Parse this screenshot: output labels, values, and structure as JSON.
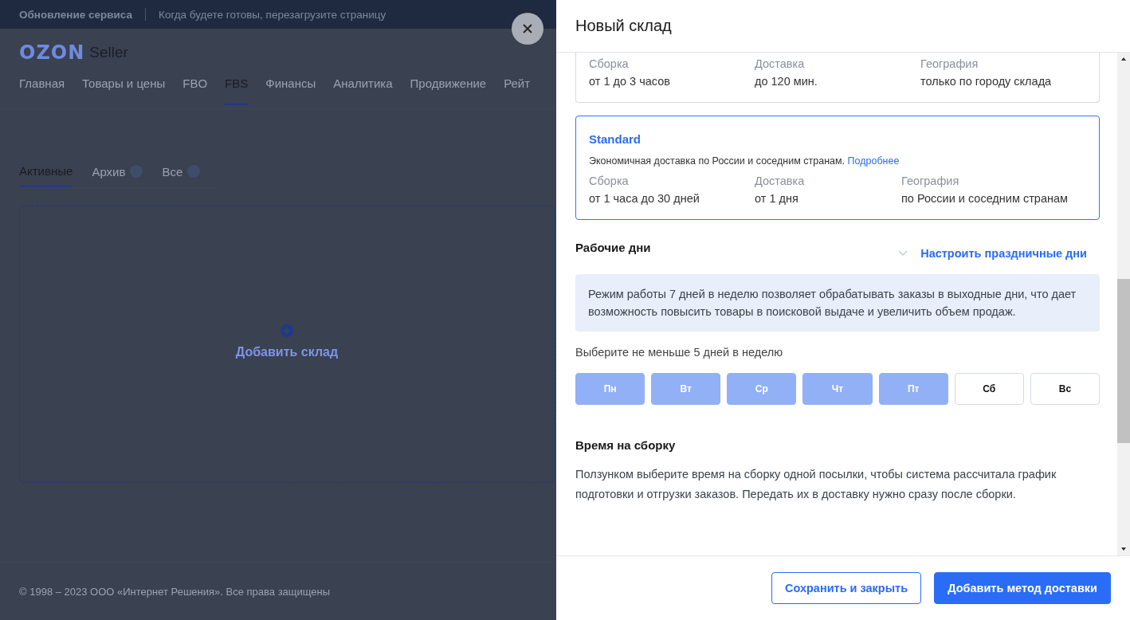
{
  "banner": {
    "title": "Обновление сервиса",
    "text": "Когда будете готовы, перезагрузите страницу"
  },
  "logo": {
    "brand": "OZON",
    "product": "Seller"
  },
  "nav": [
    {
      "label": "Главная",
      "selected": false
    },
    {
      "label": "Товары и цены",
      "selected": false
    },
    {
      "label": "FBO",
      "selected": false
    },
    {
      "label": "FBS",
      "selected": true
    },
    {
      "label": "Финансы",
      "selected": false
    },
    {
      "label": "Аналитика",
      "selected": false
    },
    {
      "label": "Продвижение",
      "selected": false
    },
    {
      "label": "Рейт",
      "selected": false
    }
  ],
  "tabs": [
    {
      "label": "Активные",
      "selected": true,
      "info": false
    },
    {
      "label": "Архив",
      "selected": false,
      "info": true
    },
    {
      "label": "Все",
      "selected": false,
      "info": true
    }
  ],
  "add_warehouse": "Добавить склад",
  "footer": "© 1998 – 2023 ООО «Интернет Решения». Все права защищены",
  "panel": {
    "title": "Новый склад",
    "methods": [
      {
        "selected": false,
        "facts": [
          {
            "label": "Сборка",
            "value": "от 1 до 3 часов"
          },
          {
            "label": "Доставка",
            "value": "до 120 мин."
          },
          {
            "label": "География",
            "value": "только по городу склада"
          }
        ]
      },
      {
        "name": "Standard",
        "selected": true,
        "description": "Экономичная доставка по России и соседним странам.",
        "link": "Подробнее",
        "facts": [
          {
            "label": "Сборка",
            "value": "от 1 часа до 30 дней"
          },
          {
            "label": "Доставка",
            "value": "от 1 дня"
          },
          {
            "label": "География",
            "value": "по России и соседним странам"
          }
        ]
      }
    ],
    "workdays_title": "Рабочие дни",
    "holidays_link": "Настроить праздничные дни",
    "workdays_info": "Режим работы 7 дней в неделю позволяет обрабатывать заказы в выходные дни, что дает возможность повысить товары в поисковой выдаче и увеличить объем продаж.",
    "days_hint": "Выберите не меньше 5 дней в неделю",
    "days": [
      {
        "label": "Пн",
        "selected": true
      },
      {
        "label": "Вт",
        "selected": true
      },
      {
        "label": "Ср",
        "selected": true
      },
      {
        "label": "Чт",
        "selected": true
      },
      {
        "label": "Пт",
        "selected": true
      },
      {
        "label": "Сб",
        "selected": false
      },
      {
        "label": "Вс",
        "selected": false
      }
    ],
    "assembly_title": "Время на сборку",
    "assembly_text": "Ползунком выберите время на сборку одной посылки, чтобы система рассчитала график подготовки и отгрузки заказов. Передать их в доставку нужно сразу после сборки.",
    "buttons": [
      {
        "label": "Сохранить и закрыть",
        "kind": "secondary"
      },
      {
        "label": "Добавить метод доставки",
        "kind": "primary"
      }
    ]
  }
}
